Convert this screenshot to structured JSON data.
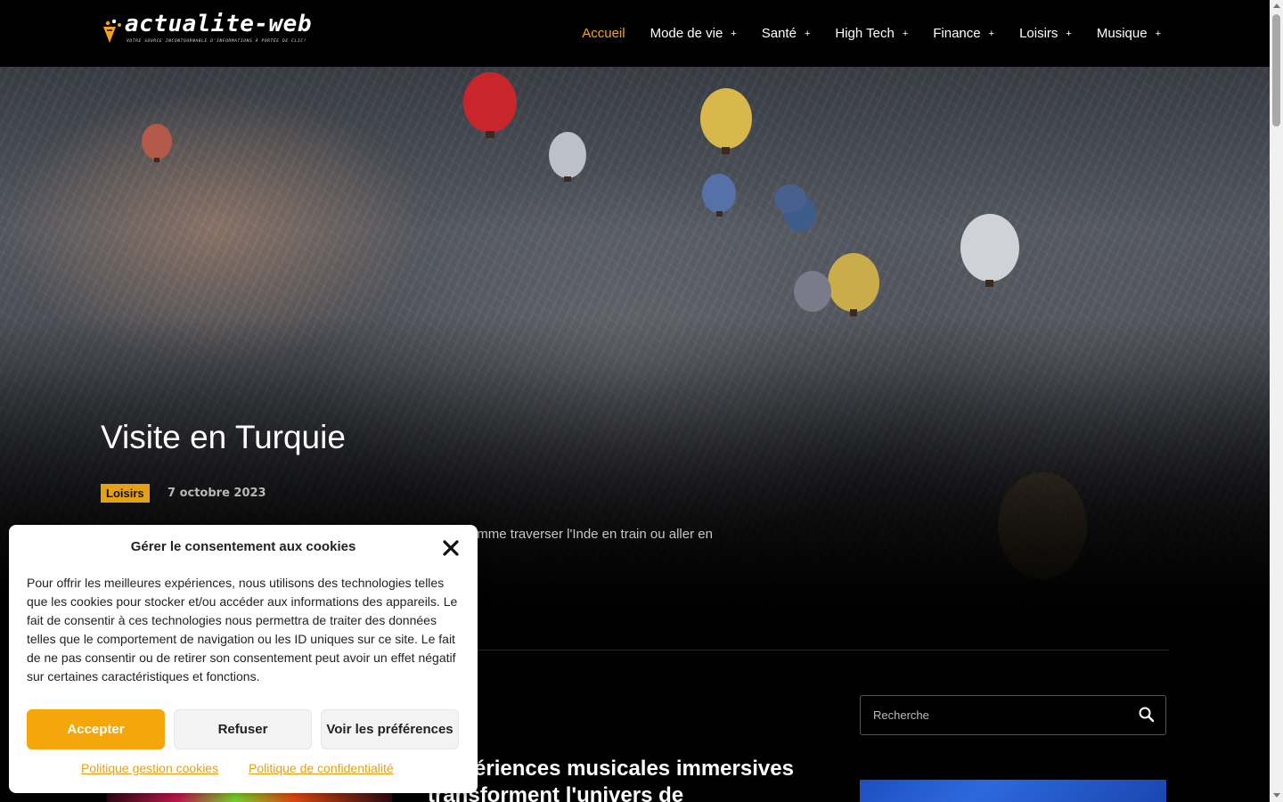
{
  "site": {
    "logo_text": "actualite-web",
    "logo_tagline": "Votre source incontournable d'informations à portée de clic!"
  },
  "nav": {
    "items": [
      {
        "label": "Accueil",
        "active": true,
        "has_submenu": false
      },
      {
        "label": "Mode de vie",
        "active": false,
        "has_submenu": true
      },
      {
        "label": "Santé",
        "active": false,
        "has_submenu": true
      },
      {
        "label": "High Tech",
        "active": false,
        "has_submenu": true
      },
      {
        "label": "Finance",
        "active": false,
        "has_submenu": true
      },
      {
        "label": "Loisirs",
        "active": false,
        "has_submenu": true
      },
      {
        "label": "Musique",
        "active": false,
        "has_submenu": true
      }
    ],
    "submenu_icon": "+"
  },
  "hero": {
    "title": "Visite en Turquie",
    "category": "Loisirs",
    "date": "7 octobre 2023",
    "excerpt": "…duellement plutôt qu'en tournée. Nous privilégions les …e, comme traverser l'Inde en train ou aller en"
  },
  "search": {
    "placeholder": "Recherche",
    "icon": "search-icon"
  },
  "article": {
    "title": "…xpériences musicales immersives transforment l'univers de"
  },
  "cookie": {
    "title": "Gérer le consentement aux cookies",
    "body": "Pour offrir les meilleures expériences, nous utilisons des technologies telles que les cookies pour stocker et/ou accéder aux informations des appareils. Le fait de consentir à ces technologies nous permettra de traiter des données telles que le comportement de navigation ou les ID uniques sur ce site. Le fait de ne pas consentir ou de retirer son consentement peut avoir un effet négatif sur certaines caractéristiques et fonctions.",
    "accept_label": "Accepter",
    "refuse_label": "Refuser",
    "prefs_label": "Voir les préférences",
    "link_cookies": "Politique gestion cookies",
    "link_privacy": "Politique de confidentialité",
    "close_icon": "close-icon"
  },
  "colors": {
    "accent": "#f5a21b",
    "background": "#000000",
    "badge": "#e6a014"
  }
}
